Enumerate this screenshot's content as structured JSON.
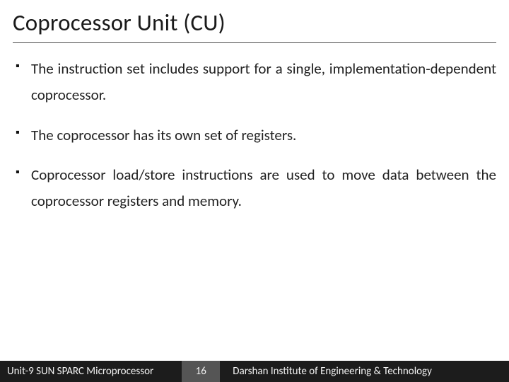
{
  "title": "Coprocessor Unit (CU)",
  "bullets": [
    "The instruction set includes support for a single, implementation-dependent coprocessor.",
    "The coprocessor has its own set of registers.",
    "Coprocessor load/store instructions are used to move data between the coprocessor registers and memory."
  ],
  "footer": {
    "left": "Unit-9 SUN SPARC Microprocessor",
    "page": "16",
    "right": "Darshan Institute of Engineering & Technology"
  }
}
